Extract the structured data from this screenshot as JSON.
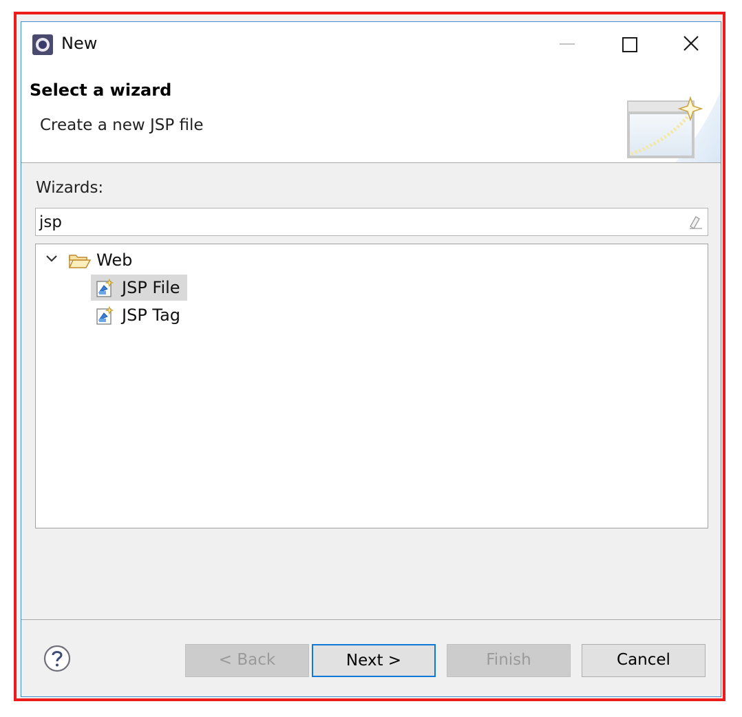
{
  "window": {
    "title": "New"
  },
  "banner": {
    "title": "Select a wizard",
    "description": "Create a new JSP file"
  },
  "wizards": {
    "label": "Wizards:",
    "filter_value": "jsp",
    "tree": {
      "category": "Web",
      "items": [
        "JSP File",
        "JSP Tag"
      ],
      "selected": "JSP File"
    }
  },
  "buttons": {
    "back": "< Back",
    "next": "Next >",
    "finish": "Finish",
    "cancel": "Cancel"
  },
  "icons": {
    "app": "eclipse-icon",
    "minimize": "minimize-icon",
    "maximize": "maximize-icon",
    "close": "close-icon",
    "banner": "new-wizard-banner-icon",
    "clear": "clear-filter-icon",
    "expand": "chevron-down-icon",
    "folder": "open-folder-icon",
    "jsp": "jsp-file-icon",
    "help": "help-icon"
  },
  "colors": {
    "highlight_border": "#ee1b1b",
    "window_border": "#3f8fd2",
    "default_button_border": "#0f78d7",
    "selection": "#d9d9d9"
  }
}
